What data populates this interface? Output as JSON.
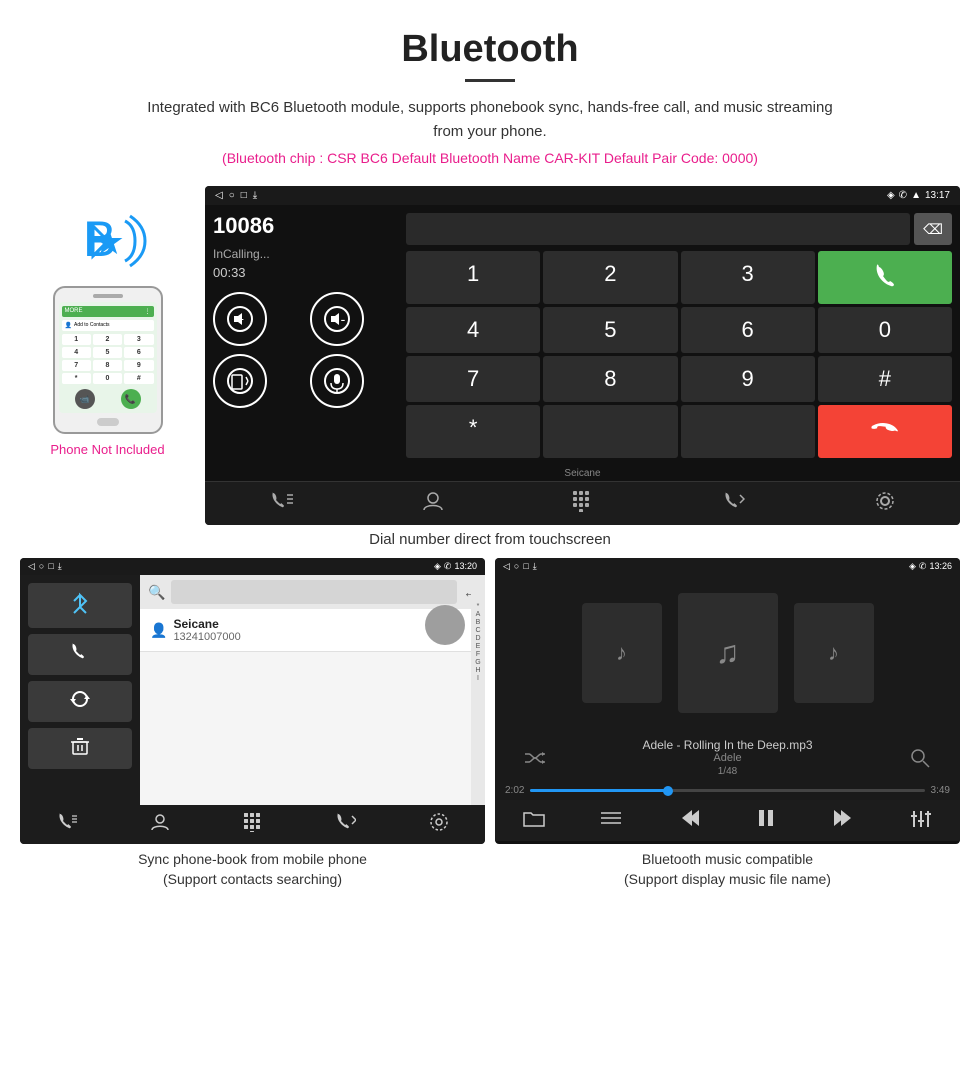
{
  "header": {
    "title": "Bluetooth",
    "description": "Integrated with BC6 Bluetooth module, supports phonebook sync, hands-free call, and music streaming from your phone.",
    "specs": "(Bluetooth chip : CSR BC6    Default Bluetooth Name CAR-KIT    Default Pair Code: 0000)"
  },
  "phone_illustration": {
    "not_included_label": "Phone Not Included"
  },
  "dial_screen": {
    "status_bar": {
      "nav_back": "◁",
      "nav_home": "○",
      "nav_square": "□",
      "nav_download": "⤓",
      "location_icon": "♦",
      "call_icon": "✆",
      "wifi_icon": "▲",
      "time": "13:17"
    },
    "dial_number": "10086",
    "calling_status": "InCalling...",
    "timer": "00:33",
    "numpad": [
      "1",
      "2",
      "3",
      "*",
      "4",
      "5",
      "6",
      "0",
      "7",
      "8",
      "9",
      "#"
    ],
    "call_green_label": "📞",
    "call_red_label": "📞"
  },
  "caption_main": "Dial number direct from touchscreen",
  "phonebook_screen": {
    "status_bar_time": "13:20",
    "contact_name": "Seicane",
    "contact_phone": "13241007000",
    "alpha_letters": [
      "*",
      "A",
      "B",
      "C",
      "D",
      "E",
      "F",
      "G",
      "H",
      "I"
    ]
  },
  "music_screen": {
    "status_bar_time": "13:26",
    "track_name": "Adele - Rolling In the Deep.mp3",
    "artist": "Adele",
    "position": "1/48",
    "time_current": "2:02",
    "time_total": "3:49"
  },
  "bottom_captions": {
    "phonebook": "Sync phone-book from mobile phone\n(Support contacts searching)",
    "music": "Bluetooth music compatible\n(Support display music file name)"
  }
}
